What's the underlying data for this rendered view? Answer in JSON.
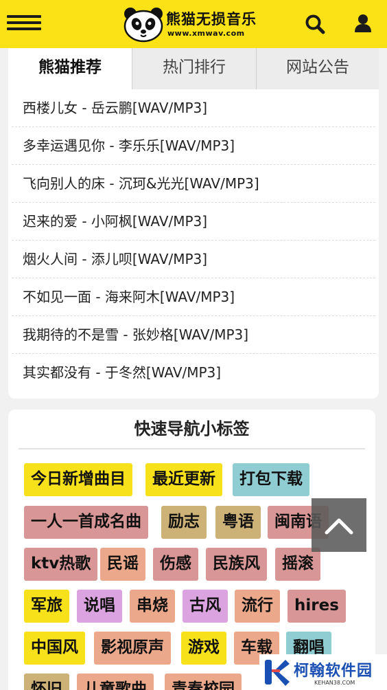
{
  "header": {
    "logo_text": "熊猫无损音乐",
    "logo_domain": "www.xmwav.com",
    "icons": [
      "menu-icon",
      "panda-logo",
      "search-icon",
      "user-icon"
    ]
  },
  "tabs": [
    {
      "label": "熊猫推荐",
      "active": true
    },
    {
      "label": "热门排行",
      "active": false
    },
    {
      "label": "网站公告",
      "active": false
    }
  ],
  "songs": [
    "西楼儿女 - 岳云鹏[WAV/MP3]",
    "多幸运遇见你 - 李乐乐[WAV/MP3]",
    "飞向别人的床 - 沉珂&光光[WAV/MP3]",
    "迟来的爱 - 小阿枫[WAV/MP3]",
    "烟火人间 - 添儿呗[WAV/MP3]",
    "不如见一面 - 海来阿木[WAV/MP3]",
    "我期待的不是雪 - 张妙格[WAV/MP3]",
    "其实都没有 - 于冬然[WAV/MP3]"
  ],
  "nav": {
    "title": "快速导航小标签",
    "tags": [
      "今日新增曲目",
      "最近更新",
      "打包下载",
      "一人一首成名曲",
      "励志",
      "粤语",
      "闽南语",
      "ktv热歌",
      "民谣",
      "伤感",
      "民族风",
      "摇滚",
      "军旅",
      "说唱",
      "串烧",
      "古风",
      "流行",
      "hires",
      "中国风",
      "影视原声",
      "游戏",
      "车载",
      "翻唱",
      "怀旧",
      "儿童歌曲",
      "青春校园"
    ]
  },
  "colors": {
    "header_bg": "#fbe217",
    "yellow": "#f7e11a",
    "cyan": "#8fcdd3",
    "rose": "#d99696",
    "khaki": "#cdb277",
    "violet": "#dba3df",
    "peach": "#eca88b"
  },
  "back_to_top_icon": "chevron-up-icon",
  "watermark": {
    "text": "柯翰软件园",
    "sub": "KEHAN38.COM"
  }
}
